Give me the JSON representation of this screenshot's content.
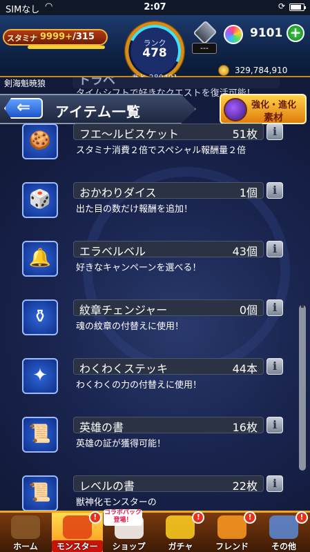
{
  "statusbar": {
    "carrier": "SIMなし",
    "time": "2:07"
  },
  "header": {
    "stamina_label": "スタミナ",
    "stamina_current": "9999+",
    "stamina_max": "/315",
    "stamina_fill_fraction": 1.0,
    "rank_label": "ランク",
    "rank_value": "478",
    "rank_next": "あと 280491",
    "gem_count": "---",
    "orb_count": "9101",
    "orb_plus": "+",
    "gold_amount": "329,784,910"
  },
  "character_name": "剣海魁暁狼",
  "prev_item": {
    "name": "トラベ",
    "desc": "タイムシフトで好きなクエストを復活可能！"
  },
  "title_bar": {
    "back_symbol": "⇐",
    "title": "アイテム一覧"
  },
  "evolve_button": {
    "line1": "強化・進化",
    "line2": "素材"
  },
  "items": [
    {
      "name": "フエ～ルビスケット",
      "count": "51枚",
      "desc": "スタミナ消費２倍でスペシャル報酬量２倍",
      "icon": "biscuit-icon",
      "symbol": "🍪"
    },
    {
      "name": "おかわりダイス",
      "count": "1個",
      "desc": "出た目の数だけ報酬を追加！",
      "icon": "dice-icon",
      "symbol": "🎲"
    },
    {
      "name": "エラベルベル",
      "count": "43個",
      "desc": "好きなキャンペーンを選べる！",
      "icon": "bell-icon",
      "symbol": "🔔"
    },
    {
      "name": "紋章チェンジャー",
      "count": "0個",
      "desc": "魂の紋章の付替えに使用！",
      "icon": "emblem-changer-icon",
      "symbol": "⚱"
    },
    {
      "name": "わくわくステッキ",
      "count": "44本",
      "desc": "わくわくの力の付替えに使用！",
      "icon": "stick-icon",
      "symbol": "✦"
    },
    {
      "name": "英雄の書",
      "count": "16枚",
      "desc": "英雄の証が獲得可能！",
      "icon": "hero-book-icon",
      "symbol": "📜"
    },
    {
      "name": "レベルの書",
      "count": "22枚",
      "desc": "獣神化モンスターの",
      "icon": "level-book-icon",
      "symbol": "📜"
    }
  ],
  "info_label": "i",
  "nav": {
    "collab_tag": "コラボパック登場！",
    "items": [
      {
        "label": "ホーム",
        "badge": ""
      },
      {
        "label": "モンスター",
        "badge": "!"
      },
      {
        "label": "ショップ",
        "badge": ""
      },
      {
        "label": "ガチャ",
        "badge": "!"
      },
      {
        "label": "フレンド",
        "badge": "!"
      },
      {
        "label": "その他",
        "badge": "!"
      }
    ]
  }
}
